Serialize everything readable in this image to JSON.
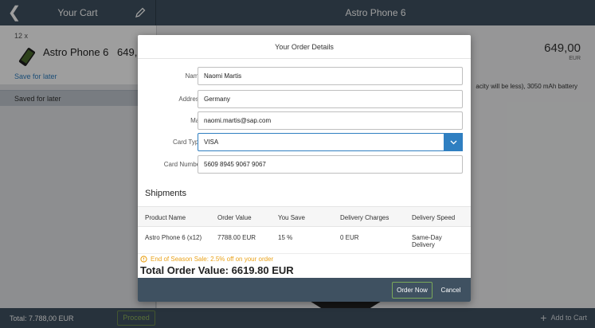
{
  "app": {
    "master_title": "Your Cart",
    "detail_title": "Astro Phone 6"
  },
  "cart": {
    "quantity": "12 x",
    "item_name": "Astro Phone 6",
    "item_price": "649,",
    "save_for_later": "Save for later",
    "saved_for_later_header": "Saved for later"
  },
  "detail": {
    "price": "649,00",
    "currency": "EUR",
    "description_fragment": "acity will be less), 3050 mAh battery"
  },
  "footer": {
    "total": "Total: 7.788,00 EUR",
    "proceed_label": "Proceed",
    "add_to_cart_label": "Add to Cart"
  },
  "dialog": {
    "title": "Your Order Details",
    "form": {
      "name_label": "Name:",
      "name_value": "Naomi Martis",
      "address_label": "Address:",
      "address_value": "Germany",
      "mail_label": "Mail:",
      "mail_value": "naomi.martis@sap.com",
      "card_type_label": "Card Type:",
      "card_type_value": "VISA",
      "card_number_label": "Card Number:",
      "card_number_value": "5609 8945 9067 9067"
    },
    "shipments": {
      "title": "Shipments",
      "columns": [
        "Product Name",
        "Order Value",
        "You Save",
        "Delivery Charges",
        "Delivery Speed"
      ],
      "rows": [
        [
          "Astro Phone 6 (x12)",
          "7788.00 EUR",
          "15 %",
          "0 EUR",
          "Same-Day Delivery"
        ]
      ]
    },
    "sale_text": "End of Season Sale: 2.5% off on your order",
    "total_text": "Total Order Value: 6619.80 EUR",
    "order_now_label": "Order Now",
    "cancel_label": "Cancel"
  },
  "colors": {
    "shell": "#3f5161",
    "accent": "#2f7fc1",
    "sale": "#e9a21a",
    "accept_border": "#7aa85a"
  },
  "icons": [
    "back-arrow-icon",
    "edit-pencil-icon",
    "phone-icon",
    "dropdown-arrow-icon",
    "sale-info-icon",
    "plus-icon"
  ]
}
